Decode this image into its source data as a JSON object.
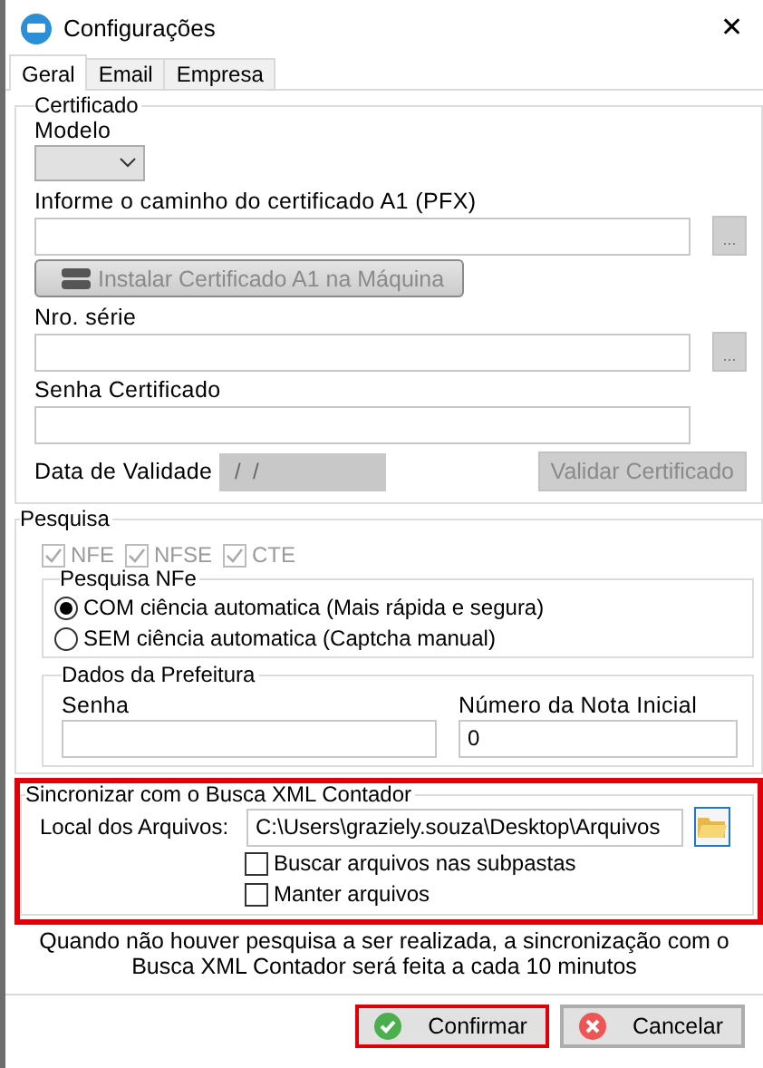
{
  "window": {
    "title": "Configurações",
    "close": "✕"
  },
  "tabs": [
    {
      "label": "Geral",
      "selected": true
    },
    {
      "label": "Email",
      "selected": false
    },
    {
      "label": "Empresa",
      "selected": false
    }
  ],
  "certificado": {
    "title": "Certificado",
    "modelo_label": "Modelo",
    "caminho_label": "Informe o caminho do certificado A1 (PFX)",
    "browse_caminho": "...",
    "install_button": {
      "label": "Instalar Certificado A1 na Máquina",
      "disabled": true
    },
    "serie_label": "Nro. série",
    "browse_serie": "...",
    "senha_label": "Senha Certificado",
    "validade_label": "Data de Validade",
    "validade_value": " /  /",
    "validar_button": {
      "label": "Validar Certificado",
      "disabled": true
    }
  },
  "pesquisa": {
    "title": "Pesquisa",
    "checkboxes": [
      {
        "label": "NFE",
        "checked": true,
        "disabled": true
      },
      {
        "label": "NFSE",
        "checked": true,
        "disabled": true
      },
      {
        "label": "CTE",
        "checked": true,
        "disabled": true
      }
    ],
    "nfe": {
      "title": "Pesquisa NFe",
      "options": [
        {
          "label": "COM ciência automatica (Mais rápida e segura)",
          "selected": true
        },
        {
          "label": "SEM ciência automatica (Captcha manual)",
          "selected": false
        }
      ]
    },
    "prefeitura": {
      "title": "Dados da Prefeitura",
      "senha_label": "Senha",
      "nota_label": "Número da Nota Inicial",
      "nota_value": "0"
    }
  },
  "sincronizar": {
    "title": "Sincronizar com o Busca XML Contador",
    "highlighted": true,
    "local_label": "Local dos Arquivos:",
    "local_value": "C:\\Users\\graziely.souza\\Desktop\\Arquivos",
    "options": [
      {
        "label": "Buscar arquivos nas subpastas",
        "checked": false
      },
      {
        "label": "Manter arquivos",
        "checked": false
      }
    ]
  },
  "note": "Quando não houver pesquisa a ser realizada, a sincronização com o Busca XML Contador será feita a cada 10 minutos",
  "buttons": [
    {
      "kind": "confirm",
      "label": "Confirmar",
      "highlighted": true
    },
    {
      "kind": "cancel",
      "label": "Cancelar",
      "highlighted": false
    }
  ]
}
